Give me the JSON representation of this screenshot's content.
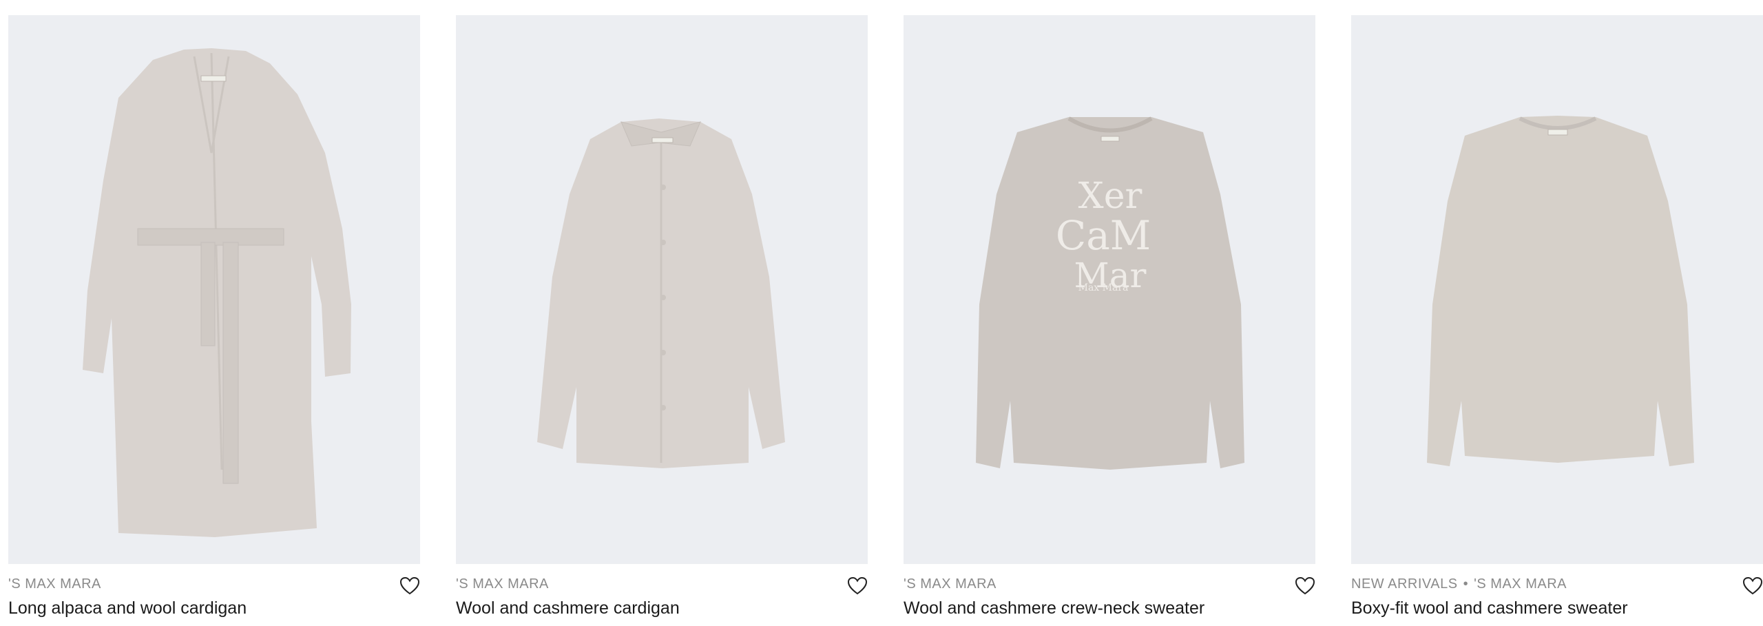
{
  "products": [
    {
      "eyebrow": "'S MAX MARA",
      "eyebrow_extra": "",
      "title": "Long alpaca and wool cardigan",
      "image_alt": "cardigan",
      "wishlist_icon": "heart-outline-icon"
    },
    {
      "eyebrow": "'S MAX MARA",
      "eyebrow_extra": "",
      "title": "Wool and cashmere cardigan",
      "image_alt": "cardigan",
      "wishlist_icon": "heart-outline-icon"
    },
    {
      "eyebrow": "'S MAX MARA",
      "eyebrow_extra": "",
      "title": "Wool and cashmere crew-neck sweater",
      "image_alt": "sweater",
      "wishlist_icon": "heart-outline-icon"
    },
    {
      "eyebrow": "'S MAX MARA",
      "eyebrow_extra": "NEW ARRIVALS",
      "title": "Boxy-fit wool and cashmere sweater",
      "image_alt": "sweater",
      "wishlist_icon": "heart-outline-icon"
    }
  ],
  "print_text": "Max Mara",
  "colors": {
    "image_background": "#eceef2",
    "garment": "#d9d3cf",
    "garment_shadow": "#cbc5c0",
    "eyebrow_text": "#8a8a8a",
    "title_text": "#1a1a1a"
  }
}
